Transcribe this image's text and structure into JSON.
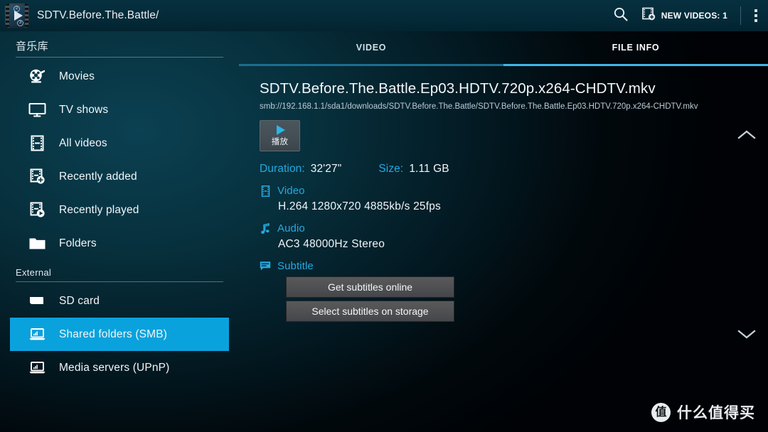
{
  "window": {
    "title": "SDTV.Before.The.Battle/",
    "app_icon": "video-player-icon"
  },
  "topbar": {
    "search_icon": "search-icon",
    "new_videos_icon": "new-video-icon",
    "new_videos_label": "NEW VIDEOS: 1",
    "overflow_icon": "overflow-menu-icon"
  },
  "sidebar": {
    "sections": [
      {
        "title": "音乐库",
        "items": [
          {
            "label": "Movies",
            "icon": "film-reel-icon",
            "selected": false
          },
          {
            "label": "TV shows",
            "icon": "tv-icon",
            "selected": false
          },
          {
            "label": "All videos",
            "icon": "film-strip-icon",
            "selected": false
          },
          {
            "label": "Recently added",
            "icon": "film-strip-plus-icon",
            "selected": false
          },
          {
            "label": "Recently played",
            "icon": "film-strip-play-icon",
            "selected": false
          },
          {
            "label": "Folders",
            "icon": "folder-icon",
            "selected": false
          }
        ]
      },
      {
        "title": "External",
        "items": [
          {
            "label": "SD card",
            "icon": "sd-card-icon",
            "selected": false
          },
          {
            "label": "Shared folders (SMB)",
            "icon": "laptop-network-icon",
            "selected": true
          },
          {
            "label": "Media servers (UPnP)",
            "icon": "laptop-network-icon",
            "selected": false
          }
        ]
      }
    ]
  },
  "main": {
    "tabs": [
      {
        "label": "VIDEO",
        "active": false
      },
      {
        "label": "FILE INFO",
        "active": true
      }
    ],
    "file": {
      "title": "SDTV.Before.The.Battle.Ep03.HDTV.720p.x264-CHDTV.mkv",
      "path": "smb://192.168.1.1/sda1/downloads/SDTV.Before.The.Battle/SDTV.Before.The.Battle.Ep03.HDTV.720p.x264-CHDTV.mkv",
      "play_button_label": "播放",
      "play_icon": "play-icon",
      "duration_key": "Duration:",
      "duration_value": "32'27\"",
      "size_key": "Size:",
      "size_value": "1.11 GB",
      "tracks": [
        {
          "heading": "Video",
          "icon": "film-strip-icon",
          "detail": "H.264  1280x720  4885kb/s  25fps"
        },
        {
          "heading": "Audio",
          "icon": "music-note-icon",
          "detail": "AC3  48000Hz  Stereo"
        }
      ],
      "subtitle_heading": "Subtitle",
      "subtitle_icon": "subtitle-bubble-icon",
      "subtitle_buttons": [
        "Get subtitles online",
        "Select subtitles on storage"
      ]
    },
    "chevron_up_icon": "chevron-up-icon",
    "chevron_down_icon": "chevron-down-icon"
  },
  "watermark": {
    "logo_char": "值",
    "text": "什么值得买"
  },
  "colors": {
    "accent_blue": "#0aa2dc",
    "link_blue": "#25a9e0",
    "tab_active": "#3fb6e8",
    "topbar_bg": "#042a38"
  }
}
